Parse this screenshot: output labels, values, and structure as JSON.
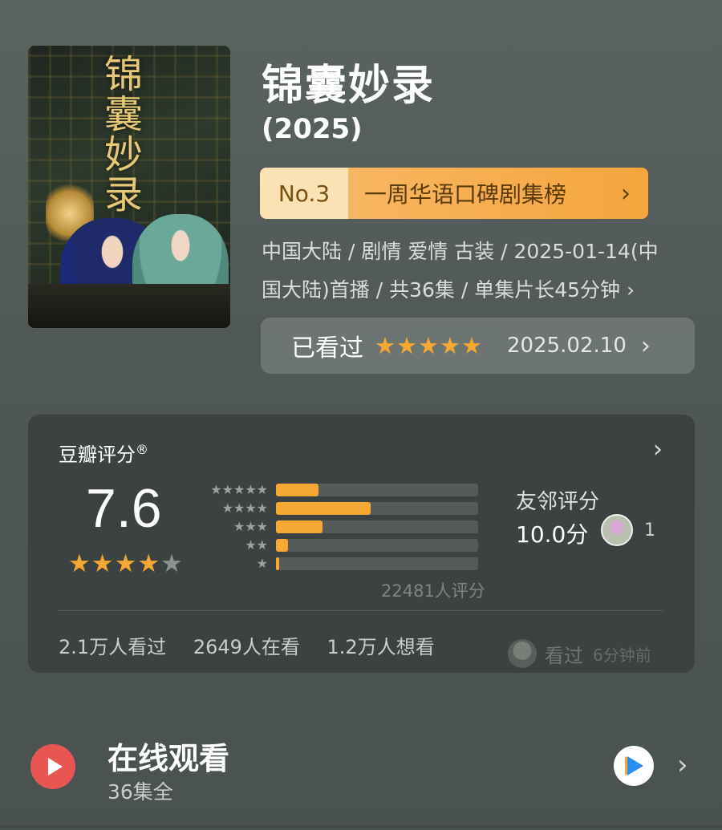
{
  "poster": {
    "calligraphy": "锦囊妙录",
    "alt": "poster"
  },
  "header": {
    "title": "锦囊妙录",
    "year": "(2025)"
  },
  "ranking": {
    "rank": "No.3",
    "list_name": "一周华语口碑剧集榜",
    "chevron": "›"
  },
  "meta": {
    "line1": "中国大陆 / 剧情 爱情 古装 / 2025-01-14(中",
    "line2": "国大陆)首播 / 共36集 / 单集片长45分钟 ›"
  },
  "watched": {
    "label": "已看过",
    "stars": "★★★★★",
    "user_rating": 5,
    "date": "2025.02.10",
    "chevron": "›"
  },
  "rating": {
    "source": "豆瓣评分",
    "registered": "®",
    "score": "7.6",
    "stars_on": "★★★★",
    "stars_off": "★",
    "star_level": 4,
    "distribution": [
      {
        "stars": "★★★★★",
        "fraction": 0.21
      },
      {
        "stars": "★★★★",
        "fraction": 0.47
      },
      {
        "stars": "★★★",
        "fraction": 0.23
      },
      {
        "stars": "★★",
        "fraction": 0.06
      },
      {
        "stars": "★",
        "fraction": 0.015
      }
    ],
    "count_text": "22481人评分",
    "friends_label": "友邻评分",
    "friends_score": "10.0分",
    "friends_count": "1",
    "stats": {
      "watched": "2.1万人看过",
      "watching": "2649人在看",
      "wish": "1.2万人想看"
    },
    "recent": {
      "action": "看过",
      "time": "6分钟前"
    },
    "chevron": "›"
  },
  "online": {
    "title": "在线观看",
    "subtitle": "36集全",
    "chevron": "›",
    "play_icon": "play-icon",
    "platform_icon": "video-platform-icon"
  },
  "colors": {
    "accent_orange": "#f5a832",
    "rank_bg": "#fbe2b4",
    "play_red": "#e95551",
    "card_bg": "#3c4242"
  }
}
